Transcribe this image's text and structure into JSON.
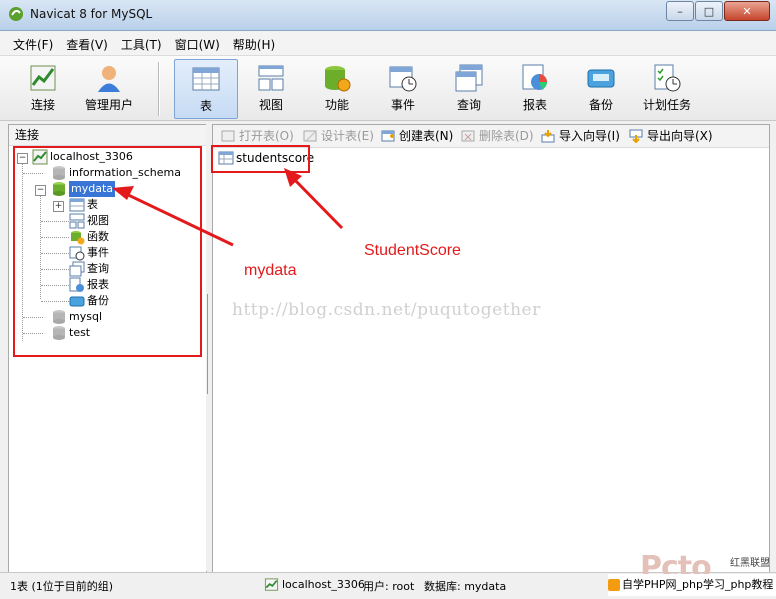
{
  "window": {
    "title": "Navicat 8 for MySQL",
    "minimize_label": "–",
    "maximize_label": "□",
    "close_label": "✕"
  },
  "menu": [
    {
      "label": "文件(F)"
    },
    {
      "label": "查看(V)"
    },
    {
      "label": "工具(T)"
    },
    {
      "label": "窗口(W)"
    },
    {
      "label": "帮助(H)"
    }
  ],
  "toolbar": [
    {
      "label": "连接",
      "icon": "connection-icon"
    },
    {
      "label": "管理用户",
      "icon": "user-icon"
    },
    {
      "label": "表",
      "icon": "table-icon",
      "active": true
    },
    {
      "label": "视图",
      "icon": "view-icon"
    },
    {
      "label": "功能",
      "icon": "function-icon"
    },
    {
      "label": "事件",
      "icon": "event-icon"
    },
    {
      "label": "查询",
      "icon": "query-icon"
    },
    {
      "label": "报表",
      "icon": "report-icon"
    },
    {
      "label": "备份",
      "icon": "backup-icon"
    },
    {
      "label": "计划任务",
      "icon": "schedule-icon"
    }
  ],
  "left_pane": {
    "header": "连接",
    "tree": {
      "connection": "localhost_3306",
      "databases": [
        "information_schema",
        "mydata",
        "mysql",
        "test"
      ],
      "selected": "mydata",
      "mydata_children": [
        "表",
        "视图",
        "函数",
        "事件",
        "查询",
        "报表",
        "备份"
      ]
    }
  },
  "object_toolbar": [
    {
      "label": "打开表(O)",
      "enabled": false
    },
    {
      "label": "设计表(E)",
      "enabled": false
    },
    {
      "label": "创建表(N)",
      "enabled": true
    },
    {
      "label": "删除表(D)",
      "enabled": false
    },
    {
      "label": "导入向导(I)",
      "enabled": true
    },
    {
      "label": "导出向导(X)",
      "enabled": true
    }
  ],
  "objects": [
    "studentscore"
  ],
  "watermark": "http://blog.csdn.net/puqutogether",
  "annotations": {
    "mydata_label": "mydata",
    "studentscore_label": "StudentScore",
    "color": "#e3191b"
  },
  "status": {
    "count": "1表 (1位于目前的组)",
    "connection": "localhost_3306",
    "user": "用户: root",
    "database": "数据库: mydata"
  },
  "corner": {
    "logo": "Pcto",
    "logo_cn": "红黑联盟",
    "banner": "自学PHP网_php学习_php教程"
  }
}
